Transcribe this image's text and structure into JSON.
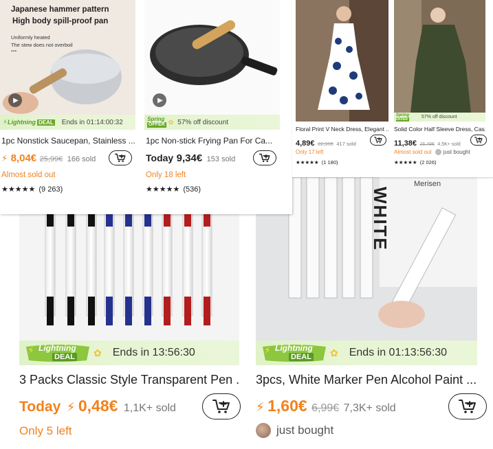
{
  "products": [
    {
      "image_text_1": "Japanese hammer pattern",
      "image_text_2": "High body spill-proof pan",
      "image_text_3": "Uniformly heated",
      "image_text_4": "The stew does not overboil",
      "image_text_5": "...",
      "badge": "Lightning DEAL",
      "badge_line1": "Lightning",
      "badge_line2": "DEAL",
      "timer": "Ends in 01:14:00:32",
      "title": "1pc Nonstick Saucepan, Stainless ...",
      "price": "8,04€",
      "old_price": "25,99€",
      "sold": "166 sold",
      "stock": "Almost sold out",
      "rating_count": "(9 263)"
    },
    {
      "badge_line1": "Spring",
      "badge_line2": "OFFER",
      "promo": "57% off discount",
      "title": "1pc Non-stick Frying Pan For Ca...",
      "price_prefix": "Today",
      "price": "9,34€",
      "sold": "153 sold",
      "stock": "Only 18 left",
      "rating_count": "(536)"
    },
    {
      "title": "Floral Print V Neck Dress, Elegant ...",
      "price": "4,89€",
      "old_price": "22,99€",
      "sold": "417 sold",
      "stock": "Only 17 left",
      "rating_count": "(1 180)"
    },
    {
      "badge_line1": "Spring",
      "badge_line2": "OFFER",
      "promo": "57% off discount",
      "title": "Solid Color Half Sleeve Dress, Cas...",
      "price": "11,38€",
      "old_price": "26,49€",
      "sold": "4,5K+ sold",
      "stock": "Almost sold out",
      "buyer": "just bought",
      "rating_count": "(2 026)"
    },
    {
      "badge_line1": "Lightning",
      "badge_line2": "DEAL",
      "timer": "Ends in 13:56:30",
      "title": "3 Packs Classic Style Transparent Pen ...",
      "price_prefix": "Today",
      "price": "0,48€",
      "sold": "1,1K+ sold",
      "stock": "Only 5 left"
    },
    {
      "image_text_1": "WHITE",
      "image_text_2": "Merisen",
      "badge_line1": "Lightning",
      "badge_line2": "DEAL",
      "timer": "Ends in 01:13:56:30",
      "title": "3pcs, White Marker Pen Alcohol Paint ...",
      "price": "1,60€",
      "old_price": "6,99€",
      "sold": "7,3K+ sold",
      "buyer": "just bought"
    }
  ],
  "icons": {
    "cart": "cart-add-icon",
    "lightning": "lightning-bolt-icon",
    "play": "play-icon",
    "star": "star-icon"
  },
  "colors": {
    "accent_orange": "#f0821e",
    "banner_green": "#dff2c8",
    "deal_badge": "#8dc63f"
  }
}
